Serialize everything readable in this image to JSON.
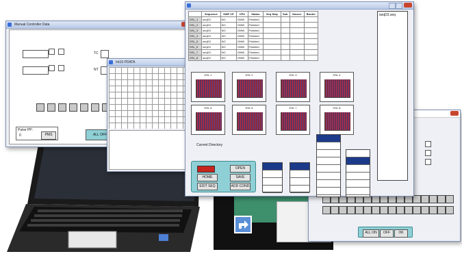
{
  "win_manual": {
    "title": "Manual Controller Data"
  },
  "win_table": {
    "title": "Int16 PDATA"
  },
  "win_main": {
    "grid": {
      "headers": [
        "",
        "Sequence",
        "SWP CP",
        "CPU",
        "Status",
        "Seq Step",
        "Sub",
        "Source",
        "Border"
      ],
      "rows": [
        [
          "DSL_1",
          "seqD3",
          "NO",
          "DMW",
          "Finished"
        ],
        [
          "DSL_2",
          "seqD3",
          "NO",
          "DMW",
          "Finished"
        ],
        [
          "DSL_3",
          "seqD3",
          "NO",
          "DMW",
          "Finished"
        ],
        [
          "DSL_4",
          "seqD3",
          "NO",
          "DMW",
          "Finished"
        ],
        [
          "DSL_5",
          "seqD3",
          "NO",
          "DMW",
          "Finished"
        ],
        [
          "DSL_6",
          "seqD3",
          "NO",
          "DMW",
          "Finished"
        ],
        [
          "DSL_7",
          "seqD3",
          "NO",
          "DMW",
          "Finished"
        ],
        [
          "DSL_8",
          "seqD3",
          "NO",
          "DMW",
          "Finished"
        ]
      ]
    },
    "list_header": "seqD3.seq",
    "plots": [
      "DSL 1",
      "DSL 2",
      "DSL 3",
      "DSL 4",
      "DSL 5",
      "DSL 6",
      "DSL 7",
      "DSL 8"
    ],
    "current_directory_label": "Current Directory",
    "buttons": {
      "home": "HOME",
      "open": "OPEN",
      "save": "SAVE",
      "load": "LOAD",
      "edit_seq": "EDIT SEQ",
      "add_cond": "ADD COND"
    }
  },
  "win_manual_panel": {
    "fields": {
      "pms_label": "Pulse PP:",
      "pms_value": "0",
      "pms_button": "PMS",
      "all_off": "ALL OFF"
    },
    "tc_label": "TC",
    "tc2_label": "NT"
  },
  "win_keys": {
    "all_on": "ALL ON",
    "off": "OFF",
    "ok": "OK"
  }
}
